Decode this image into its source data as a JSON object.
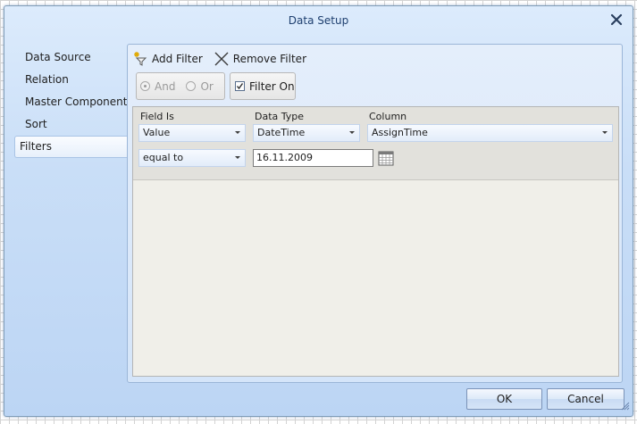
{
  "dialog": {
    "title": "Data Setup"
  },
  "sidebar": {
    "items": [
      {
        "label": "Data Source"
      },
      {
        "label": "Relation"
      },
      {
        "label": "Master Component"
      },
      {
        "label": "Sort"
      },
      {
        "label": "Filters",
        "selected": true
      }
    ]
  },
  "toolbar": {
    "add_label": "Add Filter",
    "remove_label": "Remove Filter"
  },
  "logic": {
    "and_label": "And",
    "or_label": "Or",
    "and_checked": true,
    "enabled": false
  },
  "filter_on": {
    "label": "Filter On",
    "checked": true
  },
  "filter": {
    "headers": {
      "field_is": "Field Is",
      "data_type": "Data Type",
      "column": "Column"
    },
    "field_is_value": "Value",
    "data_type_value": "DateTime",
    "column_value": "AssignTime",
    "condition_value": "equal to",
    "date_value": "16.11.2009"
  },
  "buttons": {
    "ok": "OK",
    "cancel": "Cancel"
  },
  "icons": {
    "close": "close-icon",
    "add": "add-filter-icon",
    "remove": "remove-filter-icon",
    "calendar": "calendar-icon"
  },
  "colors": {
    "title_text": "#1e3f6f",
    "accent": "#bcd5f4"
  }
}
